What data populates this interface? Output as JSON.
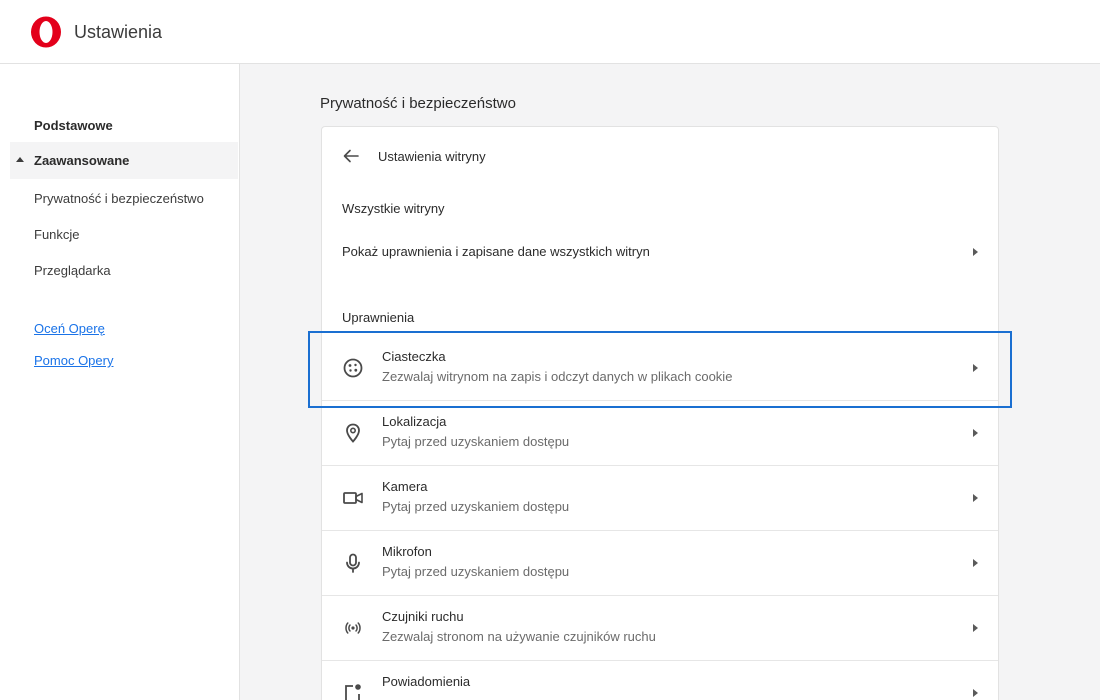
{
  "header": {
    "title": "Ustawienia"
  },
  "sidebar": {
    "basic": "Podstawowe",
    "advanced": "Zaawansowane",
    "items": [
      "Prywatność i bezpieczeństwo",
      "Funkcje",
      "Przeglądarka"
    ],
    "links": [
      "Oceń Operę",
      "Pomoc Opery"
    ]
  },
  "main": {
    "section_title": "Prywatność i bezpieczeństwo",
    "card_title": "Ustawienia witryny",
    "all_sites_header": "Wszystkie witryny",
    "all_sites_link": "Pokaż uprawnienia i zapisane dane wszystkich witryn",
    "permissions_header": "Uprawnienia",
    "permissions": [
      {
        "title": "Ciasteczka",
        "desc": "Zezwalaj witrynom na zapis i odczyt danych w plikach cookie",
        "icon": "cookie-icon"
      },
      {
        "title": "Lokalizacja",
        "desc": "Pytaj przed uzyskaniem dostępu",
        "icon": "location-pin-icon"
      },
      {
        "title": "Kamera",
        "desc": "Pytaj przed uzyskaniem dostępu",
        "icon": "camera-icon"
      },
      {
        "title": "Mikrofon",
        "desc": "Pytaj przed uzyskaniem dostępu",
        "icon": "microphone-icon"
      },
      {
        "title": "Czujniki ruchu",
        "desc": "Zezwalaj stronom na używanie czujników ruchu",
        "icon": "motion-sensor-icon"
      },
      {
        "title": "Powiadomienia",
        "desc": "",
        "icon": "notification-icon"
      }
    ]
  },
  "colors": {
    "accent": "#1a6fd1",
    "logo": "#e3001b",
    "link": "#1a73e8"
  }
}
